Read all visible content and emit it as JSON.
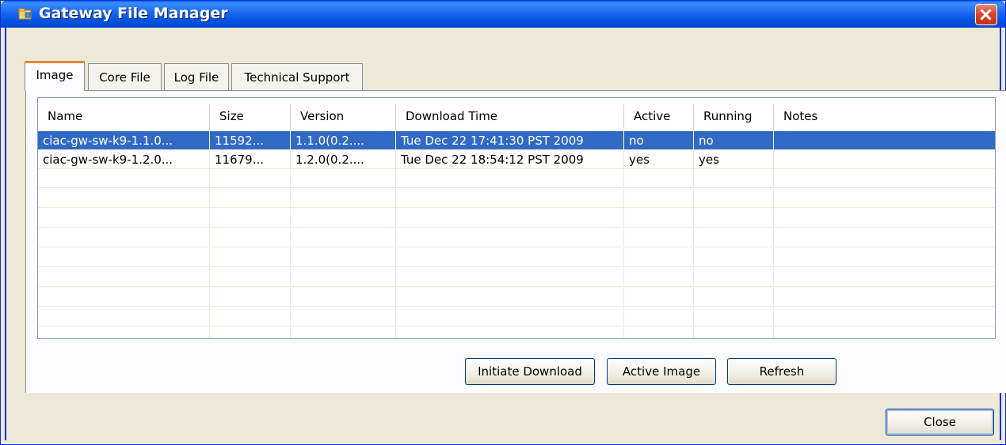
{
  "window": {
    "title": "Gateway File Manager",
    "icon": "folder-app-icon",
    "close_icon": "close-icon"
  },
  "tabs": [
    {
      "label": "Image",
      "active": true
    },
    {
      "label": "Core File",
      "active": false
    },
    {
      "label": "Log File",
      "active": false
    },
    {
      "label": "Technical Support",
      "active": false
    }
  ],
  "table": {
    "columns": [
      "Name",
      "Size",
      "Version",
      "Download Time",
      "Active",
      "Running",
      "Notes"
    ],
    "rows": [
      {
        "name": "ciac-gw-sw-k9-1.1.0...",
        "size": "11592...",
        "version": "1.1.0(0.2....",
        "download_time": "Tue Dec 22 17:41:30 PST 2009",
        "active": "no",
        "running": "no",
        "notes": "",
        "selected": true
      },
      {
        "name": "ciac-gw-sw-k9-1.2.0...",
        "size": "11679...",
        "version": "1.2.0(0.2....",
        "download_time": "Tue Dec 22 18:54:12 PST 2009",
        "active": "yes",
        "running": "yes",
        "notes": "",
        "selected": false
      }
    ]
  },
  "buttons": {
    "initiate_download": "Initiate Download",
    "active_image": "Active Image",
    "refresh": "Refresh",
    "close": "Close"
  },
  "colors": {
    "titlebar": "#0554e3",
    "selection": "#316ac5",
    "active_tab_accent": "#e68b2c"
  }
}
